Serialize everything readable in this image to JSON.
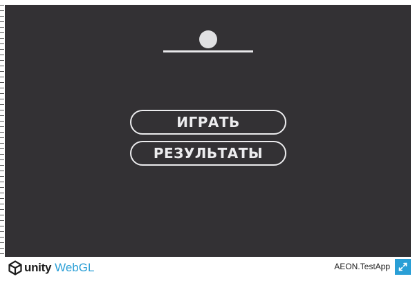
{
  "game": {
    "menu": {
      "play_label": "ИГРАТЬ",
      "results_label": "РЕЗУЛЬТАТЫ"
    },
    "colors": {
      "background": "#333134",
      "foreground": "#ececee"
    }
  },
  "footer": {
    "engine_brand": "unity",
    "platform": "WebGL",
    "app_title": "AEON.TestApp",
    "fullscreen_icon": "fullscreen-icon",
    "accent_color": "#2a9fd6"
  }
}
